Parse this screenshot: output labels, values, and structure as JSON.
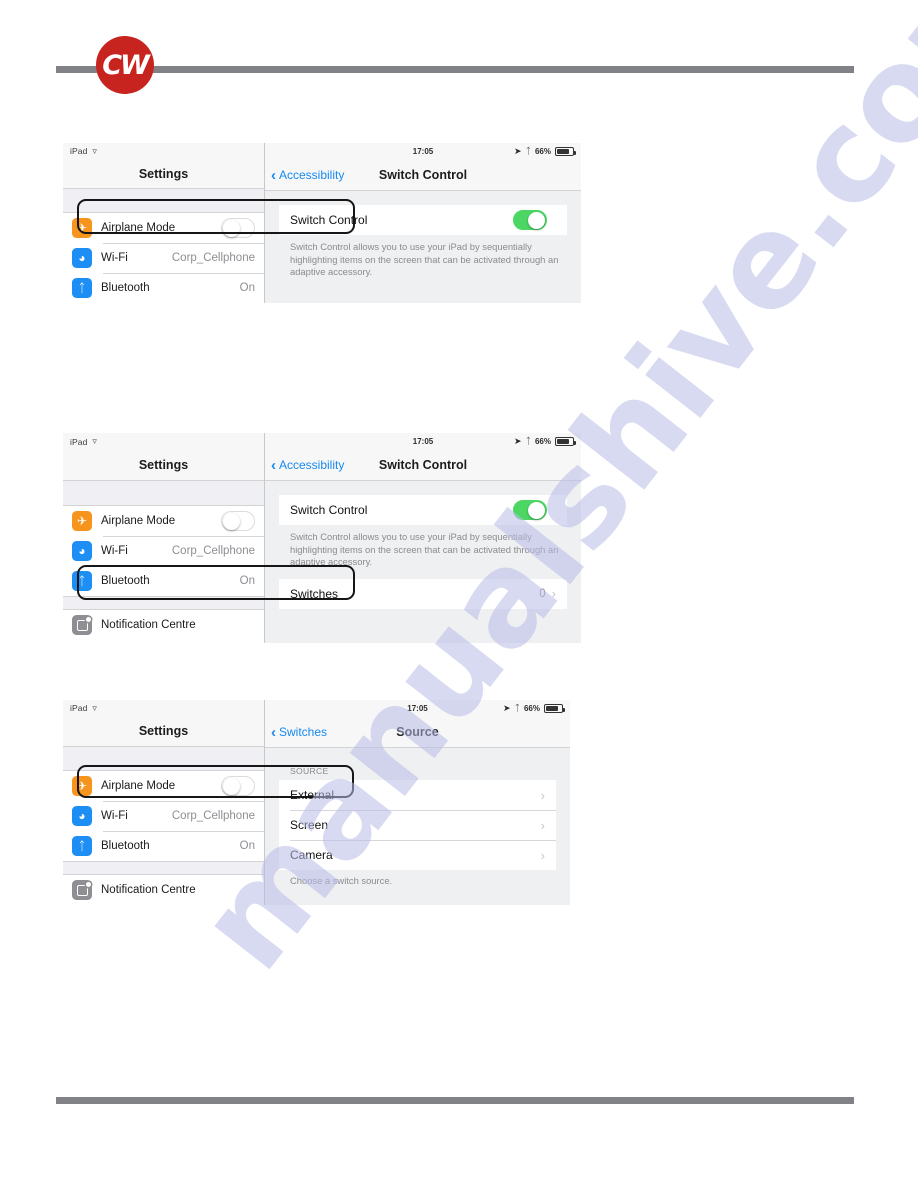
{
  "document": {
    "logo_text": "CW"
  },
  "status_bar": {
    "device": "iPad",
    "wifi_icon": "wifi-icon",
    "time": "17:05",
    "location_icon": "location-arrow-icon",
    "bluetooth_icon": "bluetooth-icon",
    "battery_percent": "66%",
    "battery_icon": "battery-icon"
  },
  "settings_pane": {
    "title": "Settings",
    "rows": [
      {
        "label": "Airplane Mode",
        "icon": "airplane-icon",
        "control": "toggle",
        "toggle_on": false,
        "value": ""
      },
      {
        "label": "Wi-Fi",
        "icon": "wifi-icon",
        "control": "value",
        "value": "Corp_Cellphone"
      },
      {
        "label": "Bluetooth",
        "icon": "bluetooth-icon",
        "control": "value",
        "value": "On"
      },
      {
        "label": "Notification Centre",
        "icon": "notification-centre-icon",
        "control": "none",
        "value": ""
      }
    ]
  },
  "panels": [
    {
      "id": "panel-switch-control-toggle",
      "nav": {
        "back_label": "Accessibility",
        "title": "Switch Control"
      },
      "switch_control": {
        "label": "Switch Control",
        "toggle_on": true,
        "description": "Switch Control allows you to use your iPad by sequentially highlighting items on the screen that can be activated through an adaptive accessory."
      },
      "highlight": "switch-control-row"
    },
    {
      "id": "panel-switches",
      "nav": {
        "back_label": "Accessibility",
        "title": "Switch Control"
      },
      "switch_control": {
        "label": "Switch Control",
        "toggle_on": true,
        "description": "Switch Control allows you to use your iPad by sequentially highlighting items on the screen that can be activated through an adaptive accessory."
      },
      "switches_row": {
        "label": "Switches",
        "value": "0",
        "chevron": "chevron-right-icon"
      },
      "highlight": "switches-row"
    },
    {
      "id": "panel-source",
      "nav": {
        "back_label": "Switches",
        "title": "Source"
      },
      "group_header": "SOURCE",
      "options": [
        {
          "label": "External",
          "chevron": "chevron-right-icon"
        },
        {
          "label": "Screen",
          "chevron": "chevron-right-icon"
        },
        {
          "label": "Camera",
          "chevron": "chevron-right-icon"
        }
      ],
      "footer_note": "Choose a switch source.",
      "highlight": "external-row"
    }
  ],
  "watermark": {
    "text": "manualshive.com"
  },
  "colors": {
    "logo_red": "#c8241f",
    "rule_gray": "#808285",
    "toggle_green": "#4cd764",
    "link_blue": "#1789ef",
    "airplane_orange": "#f7941e",
    "icon_blue": "#1c8ef4",
    "watermark_blue": "#b9bce8"
  }
}
